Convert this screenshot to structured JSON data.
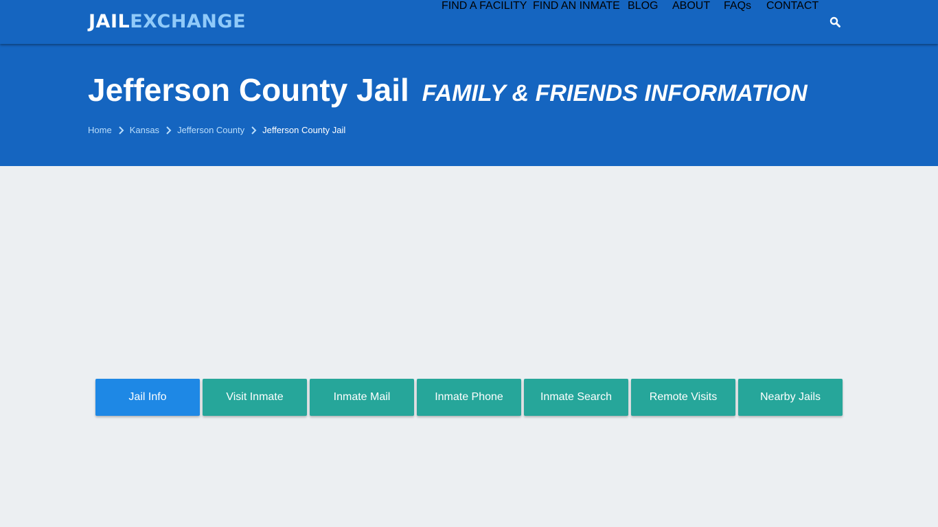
{
  "brand": {
    "part1": "JAIL",
    "part2": "EXCHANGE"
  },
  "nav": {
    "items": [
      {
        "label": "FIND A FACILITY"
      },
      {
        "label": "FIND AN INMATE"
      },
      {
        "label": "BLOG"
      },
      {
        "label": "ABOUT"
      },
      {
        "label": "FAQs"
      },
      {
        "label": "CONTACT"
      }
    ],
    "search_icon": "search-icon"
  },
  "hero": {
    "title": "Jefferson County Jail",
    "subtitle": "FAMILY & FRIENDS INFORMATION"
  },
  "breadcrumb": [
    {
      "label": "Home"
    },
    {
      "label": "Kansas"
    },
    {
      "label": "Jefferson County"
    },
    {
      "label": "Jefferson County Jail"
    }
  ],
  "tabs": [
    {
      "label": "Jail Info",
      "active": true
    },
    {
      "label": "Visit Inmate"
    },
    {
      "label": "Inmate Mail"
    },
    {
      "label": "Inmate Phone"
    },
    {
      "label": "Inmate Search"
    },
    {
      "label": "Remote Visits"
    },
    {
      "label": "Nearby Jails"
    }
  ],
  "colors": {
    "primary": "#1565c0",
    "brand_accent": "#90caf9",
    "tab_active": "#1e88e5",
    "tab": "#26a69a",
    "background": "#eceff2"
  }
}
